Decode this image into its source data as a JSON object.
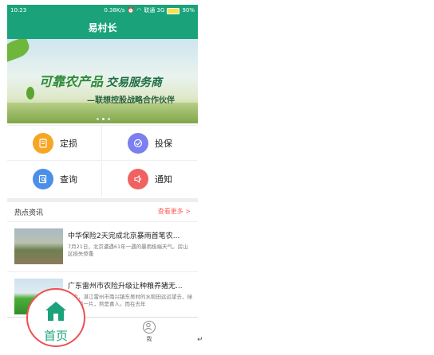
{
  "status_bar": {
    "time": "10:23",
    "net_speed": "0.38K/s",
    "carrier": "联通 3G",
    "battery": "90%"
  },
  "app_title": "易村长",
  "banner": {
    "slogan_main": "可靠农产品",
    "slogan_sub": "交易服务商",
    "tagline": "—联想控股战略合作伙伴"
  },
  "grid": [
    {
      "label": "定损",
      "icon": "document-icon",
      "color": "#f5a623"
    },
    {
      "label": "投保",
      "icon": "shield-check-icon",
      "color": "#7b7ff0"
    },
    {
      "label": "查询",
      "icon": "search-icon",
      "color": "#4a8fe8"
    },
    {
      "label": "通知",
      "icon": "speaker-icon",
      "color": "#f06262"
    }
  ],
  "news_section": {
    "title": "热点资讯",
    "more": "查看更多 >"
  },
  "news": [
    {
      "title": "中华保险2天完成北京暴雨首笔农...",
      "desc": "7月21日，北京遭遇61年一遇的暴雨极端天气。房山区损失惨重"
    },
    {
      "title": "广东雷州市农险升级让种粮养猪无...",
      "desc": "如今，湛江雷州市南兴镇东吴村的水稻田远远望去，绿油油的一片，煞是喜人。而在去年"
    }
  ],
  "tabbar": {
    "home": "首页",
    "me": "我"
  },
  "return_mark": "↵"
}
